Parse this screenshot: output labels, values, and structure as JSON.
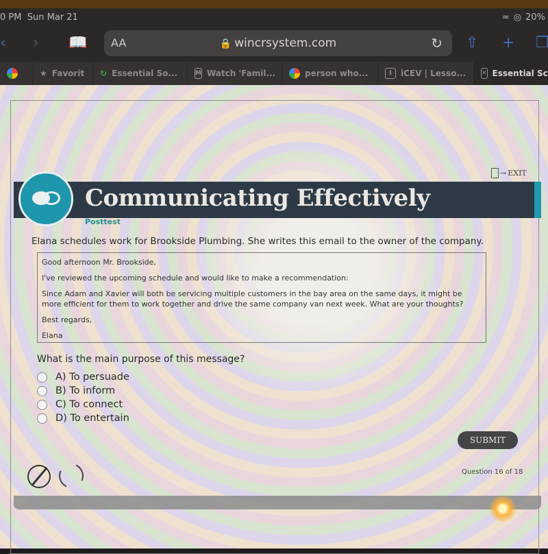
{
  "status_bar": {
    "time": "0 PM",
    "date": "Sun Mar 21",
    "battery": "20%"
  },
  "browser": {
    "text_size_label": "AA",
    "url": "wincrsystem.com",
    "tabs": [
      {
        "label": "",
        "icon": "google-icon"
      },
      {
        "label": "Favorit",
        "icon": "star-icon"
      },
      {
        "label": "Essential So...",
        "icon": "loading-icon"
      },
      {
        "label": "Watch 'Famil...",
        "icon": "m-icon"
      },
      {
        "label": "person who...",
        "icon": "google-icon"
      },
      {
        "label": "iCEV | Lesso...",
        "icon": "i-icon"
      },
      {
        "label": "Essential Sc",
        "icon": "close-icon",
        "active": true
      }
    ]
  },
  "lesson": {
    "exit_label": "EXIT",
    "title": "Communicating Effectively",
    "subtitle": "Posttest",
    "prompt": "Elana schedules work for Brookside Plumbing. She writes this email to the owner of the company.",
    "email": {
      "greeting": "Good afternoon Mr. Brookside,",
      "line1": "I've reviewed the upcoming schedule and would like to make a recommendation:",
      "line2": "Since Adam and Xavier will both be servicing multiple customers in the bay area on the same days, it might be more efficient for them to work together and drive the same company van next week. What are your thoughts?",
      "closing": "Best regards,",
      "signature": "Elana"
    },
    "question": "What is the main purpose of this message?",
    "options": [
      "A) To persuade",
      "B) To inform",
      "C) To connect",
      "D) To entertain"
    ],
    "submit_label": "SUBMIT",
    "question_counter": "Question 16 of 18"
  },
  "colors": {
    "banner": "#2d3a46",
    "accent": "#1e96ab",
    "posttest": "#2b8f8b",
    "submit": "#434546"
  }
}
